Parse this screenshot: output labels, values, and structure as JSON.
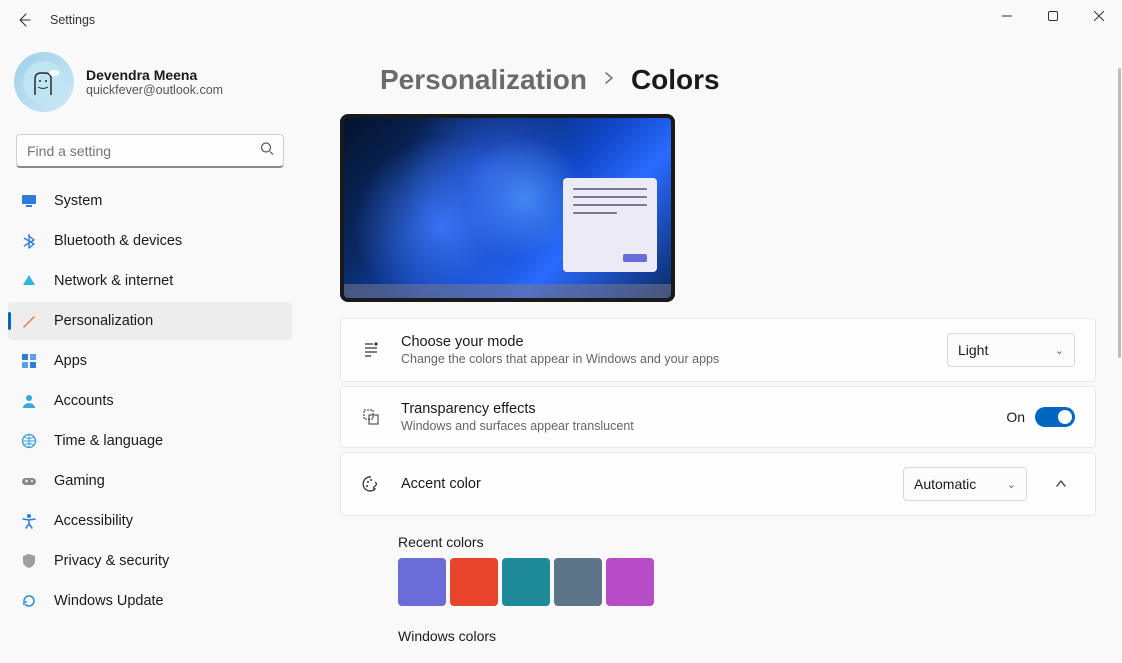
{
  "window": {
    "title": "Settings"
  },
  "profile": {
    "name": "Devendra Meena",
    "email": "quickfever@outlook.com"
  },
  "search": {
    "placeholder": "Find a setting"
  },
  "nav": {
    "items": [
      {
        "label": "System",
        "icon": "monitor"
      },
      {
        "label": "Bluetooth & devices",
        "icon": "bluetooth"
      },
      {
        "label": "Network & internet",
        "icon": "wifi"
      },
      {
        "label": "Personalization",
        "icon": "brush",
        "active": true
      },
      {
        "label": "Apps",
        "icon": "apps"
      },
      {
        "label": "Accounts",
        "icon": "person"
      },
      {
        "label": "Time & language",
        "icon": "globe"
      },
      {
        "label": "Gaming",
        "icon": "gamepad"
      },
      {
        "label": "Accessibility",
        "icon": "accessibility"
      },
      {
        "label": "Privacy & security",
        "icon": "shield"
      },
      {
        "label": "Windows Update",
        "icon": "update"
      }
    ]
  },
  "breadcrumb": {
    "parent": "Personalization",
    "current": "Colors"
  },
  "mode": {
    "title": "Choose your mode",
    "subtitle": "Change the colors that appear in Windows and your apps",
    "selected": "Light"
  },
  "transparency": {
    "title": "Transparency effects",
    "subtitle": "Windows and surfaces appear translucent",
    "state_label": "On"
  },
  "accent": {
    "title": "Accent color",
    "selected": "Automatic",
    "recent_title": "Recent colors",
    "recent": [
      "#6b6cd8",
      "#e8442c",
      "#1f8a9a",
      "#5d7586",
      "#b84cc6"
    ],
    "windows_title": "Windows colors"
  }
}
